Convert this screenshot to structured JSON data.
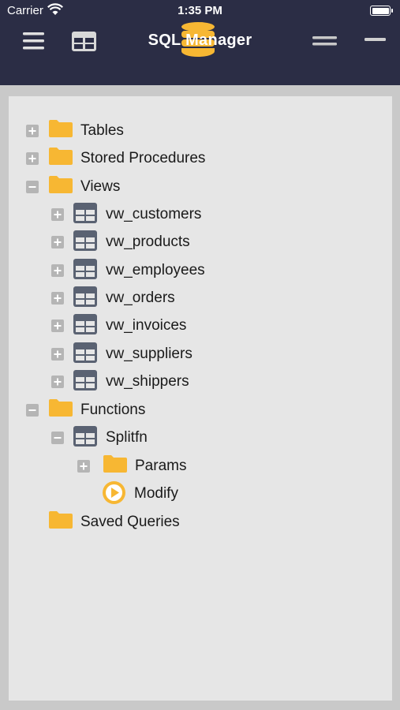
{
  "status_bar": {
    "carrier": "Carrier",
    "time": "1:35 PM"
  },
  "header": {
    "title": "SQL Manager",
    "left_icons": [
      "menu-icon",
      "grid-icon"
    ],
    "right_icons": [
      "equal-icon",
      "minus-icon"
    ]
  },
  "tree": {
    "tables": {
      "label": "Tables",
      "expanded": false
    },
    "stored_procedures": {
      "label": "Stored Procedures",
      "expanded": false
    },
    "views": {
      "label": "Views",
      "expanded": true,
      "children": [
        "vw_customers",
        "vw_products",
        "vw_employees",
        "vw_orders",
        "vw_invoices",
        "vw_suppliers",
        "vw_shippers"
      ]
    },
    "functions": {
      "label": "Functions",
      "expanded": true,
      "splitfn": {
        "label": "Splitfn",
        "expanded": true,
        "params": {
          "label": "Params",
          "expanded": false
        },
        "modify": {
          "label": "Modify"
        }
      }
    },
    "saved_queries": {
      "label": "Saved Queries"
    }
  },
  "colors": {
    "header_bg": "#2b2d45",
    "panel_bg": "#e6e6e6",
    "folder": "#f7b733",
    "table_icon": "#5a6272",
    "expander": "#b5b5b5"
  }
}
